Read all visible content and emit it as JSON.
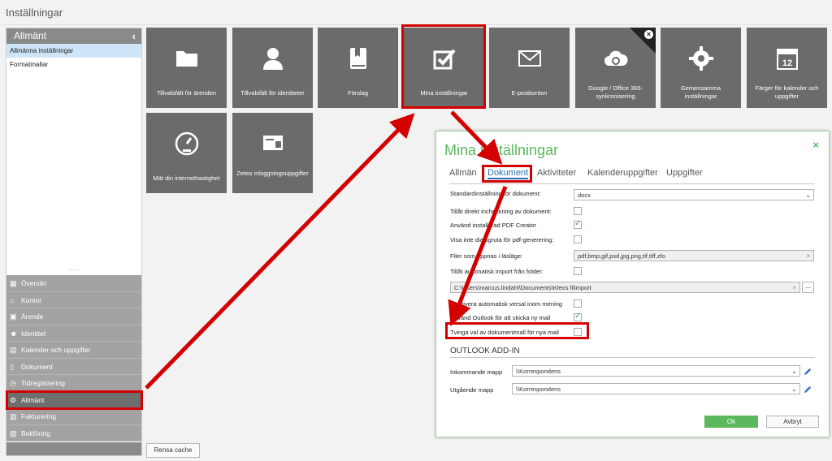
{
  "window": {
    "title": "Inställningar"
  },
  "left_panel": {
    "header": "Allmänt",
    "items": [
      {
        "label": "Allmänna inställningar",
        "selected": true
      },
      {
        "label": "Formatmallar",
        "selected": false
      }
    ]
  },
  "nav": [
    {
      "label": "Översikt",
      "icon": "grid-icon",
      "glyph": "▦"
    },
    {
      "label": "Kontor",
      "icon": "building-icon",
      "glyph": "⌂"
    },
    {
      "label": "Ärende",
      "icon": "briefcase-icon",
      "glyph": "▣"
    },
    {
      "label": "Identitet",
      "icon": "people-icon",
      "glyph": "☻"
    },
    {
      "label": "Kalender och uppgifter",
      "icon": "calendar-icon",
      "glyph": "▤"
    },
    {
      "label": "Dokument",
      "icon": "document-icon",
      "glyph": "▯"
    },
    {
      "label": "Tidregistrering",
      "icon": "clock-icon",
      "glyph": "◷"
    },
    {
      "label": "Allmänt",
      "icon": "gears-icon",
      "glyph": "⚙",
      "active": true
    },
    {
      "label": "Fakturering",
      "icon": "invoice-icon",
      "glyph": "▥"
    },
    {
      "label": "Bokföring",
      "icon": "ledger-icon",
      "glyph": "▧"
    }
  ],
  "rensa_cache": "Rensa cache",
  "tiles": [
    {
      "label": "Tillvalsfält för ärenden",
      "icon": "folder-icon"
    },
    {
      "label": "Tillvalsfält för identiteter",
      "icon": "person-icon"
    },
    {
      "label": "Förslag",
      "icon": "bookmark-book-icon"
    },
    {
      "label": "Mina inställningar",
      "icon": "checkbox-check-icon"
    },
    {
      "label": "E-postkonton",
      "icon": "envelope-icon"
    },
    {
      "label": "Google / Office 365-synkronisering",
      "icon": "cloud-sync-icon"
    },
    {
      "label": "Gemensamma inställningar",
      "icon": "gear-icon"
    },
    {
      "label": "Färger för kalender och uppgifter",
      "icon": "calendar-12-icon",
      "calendar_day": "12"
    },
    {
      "label": "Mät din internethastighet",
      "icon": "speedometer-icon"
    },
    {
      "label": "Zeteo inloggningsuppgifter",
      "icon": "id-card-icon"
    }
  ],
  "dialog": {
    "title": "Mina inställningar",
    "tabs": [
      "Allmän",
      "Dokument",
      "Aktiviteter",
      "Kalenderuppgifter",
      "Uppgifter"
    ],
    "active_tab": "Dokument",
    "rows": [
      {
        "label": "Standardinställning för dokument:",
        "type": "dropdown",
        "value": "docx"
      },
      {
        "label": "Tillåt direkt incheckning av dokument:",
        "type": "checkbox",
        "checked": false
      },
      {
        "label": "Använd installerad PDF Creator",
        "type": "checkbox",
        "checked": true
      },
      {
        "label": "Visa inte dialogruta för pdf-generering:",
        "type": "checkbox",
        "checked": false
      },
      {
        "label": "Filer som öppnas i läsläge:",
        "type": "text",
        "value": "pdf,bmp,gif,psd,jpg,png,tif,tiff,zfo"
      },
      {
        "label": "Tillåt automatisk import från folder:",
        "type": "checkbox",
        "checked": false
      },
      {
        "label": "",
        "type": "path",
        "value": "C:\\Users\\marcus.lindahl\\Documents\\Kleos filimport",
        "browse": "..."
      },
      {
        "label": "Inaktivera automatisk versal inom mening",
        "type": "checkbox",
        "checked": false
      },
      {
        "label": "Använd Outlook för att skicka ny mail",
        "type": "checkbox",
        "checked": true
      },
      {
        "label": "Tvinga val av dokumentmall för nya mail",
        "type": "checkbox",
        "checked": false
      }
    ],
    "outlook_section": "OUTLOOK ADD-IN",
    "outlook_rows": [
      {
        "label": "Inkommande mapp",
        "value": "\\\\Korrespondens"
      },
      {
        "label": "Utgående mapp",
        "value": "\\\\Korrespondens"
      }
    ],
    "ok": "Ok",
    "cancel": "Avbryt"
  },
  "colors": {
    "tile": "#6b6b6b",
    "accent_green": "#5cb85c",
    "highlight_red": "#d40000",
    "tab_blue": "#2a6fb0"
  }
}
